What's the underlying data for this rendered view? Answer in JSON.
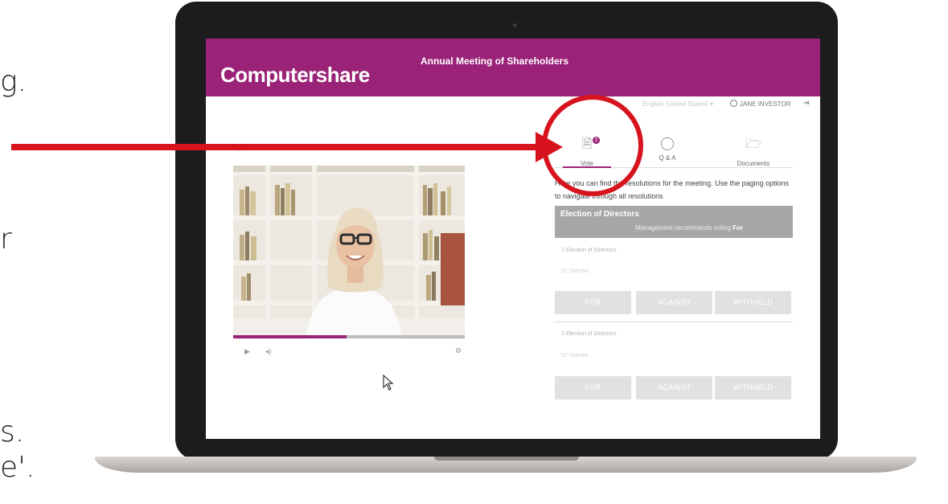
{
  "side_text": [
    "g.",
    "r",
    "s.",
    "e'."
  ],
  "app": {
    "logo": "Computershare",
    "title": "Annual Meeting of Shareholders",
    "language": "English (United States)",
    "user": "JANE INVESTOR"
  },
  "tabs": [
    {
      "label": "Vote",
      "icon": "document-icon",
      "badge": "2"
    },
    {
      "label": "Q & A",
      "icon": "chat-bubble-icon"
    },
    {
      "label": "Documents",
      "icon": "folder-icon"
    }
  ],
  "instructions": "Here you can find the resolutions for the meeting. Use the paging options to navigate through all resolutions",
  "resolution": {
    "title": "Election of Directors",
    "recommendation_prefix": "Management recommends voting",
    "recommendation_value": "For"
  },
  "items": [
    {
      "title": "1 Election of Directors",
      "sub": "01 Director"
    },
    {
      "title": "2 Election of Directors",
      "sub": "02 Director"
    }
  ],
  "vote_buttons": {
    "for": "FOR",
    "against": "AGAINST",
    "withheld": "WITHHELD"
  },
  "video": {
    "progress": 0.49
  },
  "colors": {
    "brand": "#9a2378",
    "annotation": "#d7141e"
  }
}
